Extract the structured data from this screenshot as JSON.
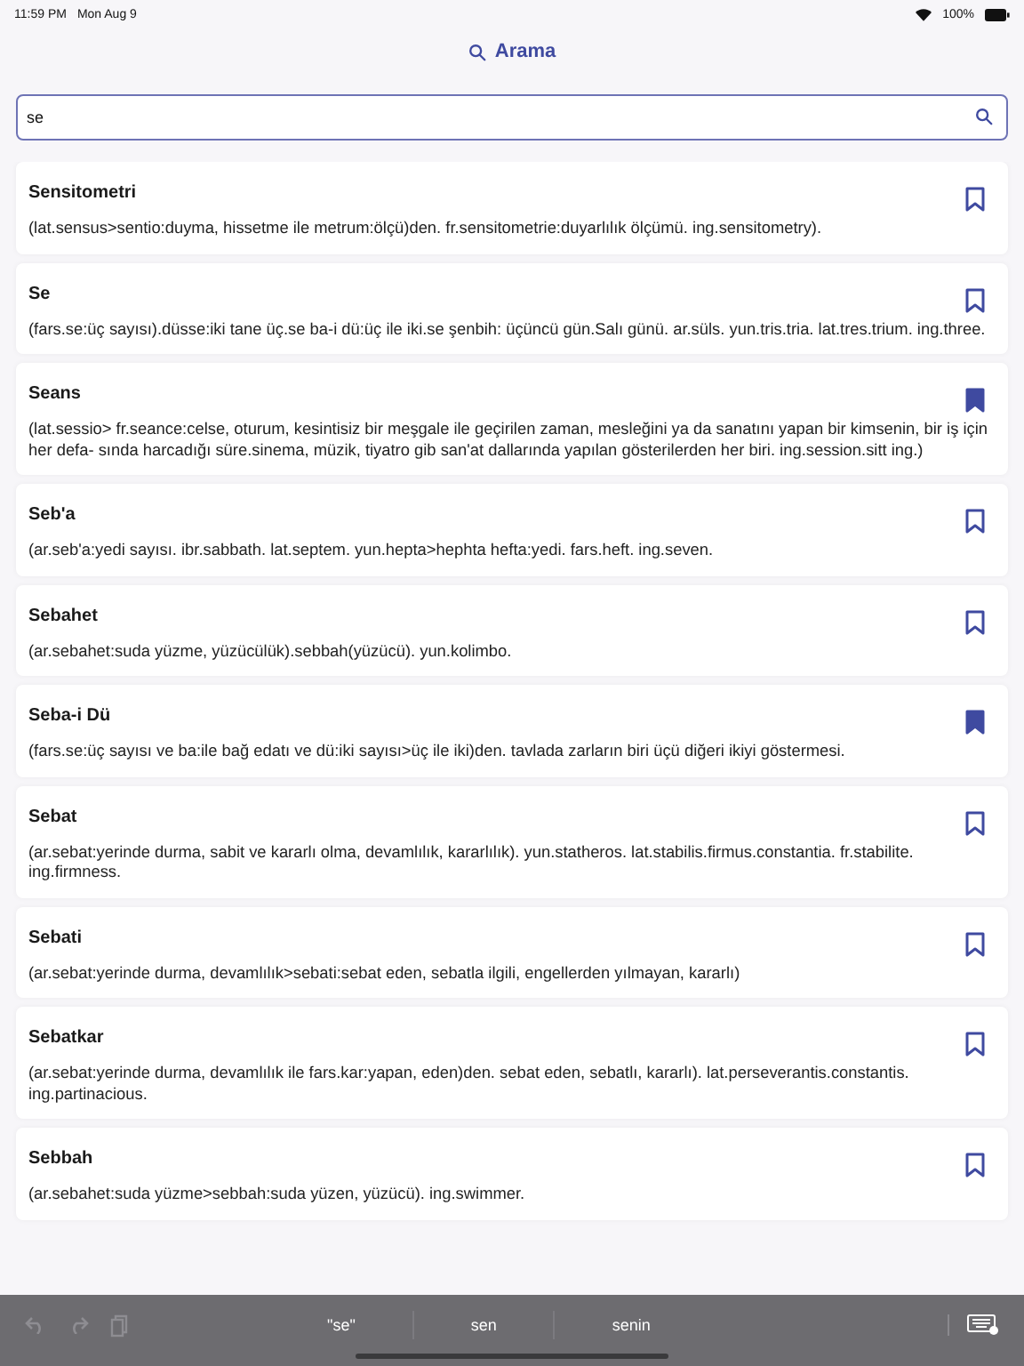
{
  "status_bar": {
    "time": "11:59 PM",
    "date": "Mon Aug 9",
    "battery": "100%"
  },
  "header": {
    "title": "Arama"
  },
  "search": {
    "value": "se"
  },
  "entries": [
    {
      "word": "Sensitometri",
      "definition": "(lat.sensus>sentio:duyma, hissetme ile metrum:ölçü)den.  fr.sensitometrie:duyarlılık ölçümü. ing.sensitometry).",
      "bookmarked": false
    },
    {
      "word": "Se",
      "definition": "(fars.se:üç sayısı).düsse:iki tane üç.se ba-i dü:üç ile iki.se şenbih: üçüncü gün.Salı günü. ar.süls. yun.tris.tria. lat.tres.trium. ing.three.",
      "bookmarked": false
    },
    {
      "word": "Seans",
      "definition": "(lat.sessio> fr.seance:celse, oturum, kesintisiz bir meşgale ile geçirilen zaman, mesleğini ya da sanatını yapan bir kimsenin, bir iş için her defa- sında harcadığı süre.sinema, müzik, tiyatro gib san'at dallarında yapılan gösterilerden her biri. ing.session.sitt ing.)",
      "bookmarked": true
    },
    {
      "word": "Seb'a",
      "definition": "(ar.seb'a:yedi sayısı. ibr.sabbath. lat.septem. yun.hepta>hephta hefta:yedi. fars.heft. ing.seven.",
      "bookmarked": false
    },
    {
      "word": "Sebahet",
      "definition": "(ar.sebahet:suda yüzme, yüzücülük).sebbah(yüzücü). yun.kolimbo.",
      "bookmarked": false
    },
    {
      "word": "Seba-i Dü",
      "definition": "(fars.se:üç sayısı ve ba:ile bağ edatı ve dü:iki sayısı>üç ile iki)den. tavlada zarların biri üçü diğeri ikiyi göstermesi.",
      "bookmarked": true
    },
    {
      "word": "Sebat",
      "definition": "(ar.sebat:yerinde durma, sabit ve kararlı olma, devamlılık, kararlılık).  yun.statheros. lat.stabilis.firmus.constantia. fr.stabilite. ing.firmness.",
      "bookmarked": false
    },
    {
      "word": "Sebati",
      "definition": "(ar.sebat:yerinde durma, devamlılık>sebati:sebat eden, sebatla ilgili, engellerden yılmayan, kararlı)",
      "bookmarked": false
    },
    {
      "word": "Sebatkar",
      "definition": "(ar.sebat:yerinde durma, devamlılık ile  fars.kar:yapan, eden)den. sebat eden, sebatlı, kararlı). lat.perseverantis.constantis. ing.partinacious.",
      "bookmarked": false
    },
    {
      "word": "Sebbah",
      "definition": "(ar.sebahet:suda yüzme>sebbah:suda yüzen, yüzücü). ing.swimmer.",
      "bookmarked": false
    }
  ],
  "keyboard_bar": {
    "suggestions": [
      "\"se\"",
      "sen",
      "senin"
    ]
  }
}
